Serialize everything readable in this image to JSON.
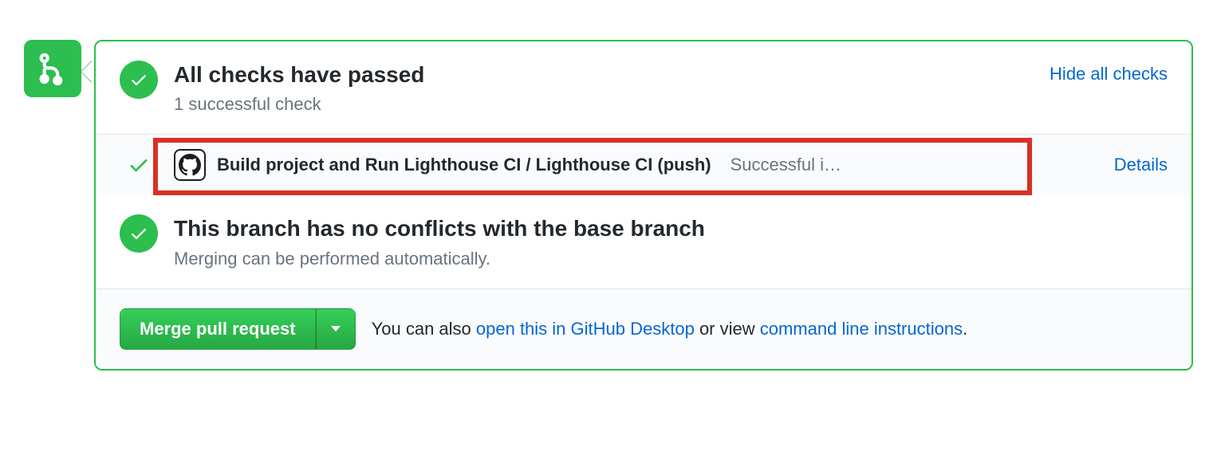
{
  "checks_header": {
    "title": "All checks have passed",
    "subtitle": "1 successful check",
    "toggle_label": "Hide all checks"
  },
  "check_item": {
    "name": "Build project and Run Lighthouse CI / Lighthouse CI (push)",
    "status_text": "Successful i…",
    "details_label": "Details"
  },
  "conflicts": {
    "title": "This branch has no conflicts with the base branch",
    "subtitle": "Merging can be performed automatically."
  },
  "merge": {
    "button_label": "Merge pull request",
    "help_prefix": "You can also ",
    "link_desktop": "open this in GitHub Desktop",
    "help_mid": " or view ",
    "link_cli": "command line instructions",
    "help_suffix": "."
  }
}
